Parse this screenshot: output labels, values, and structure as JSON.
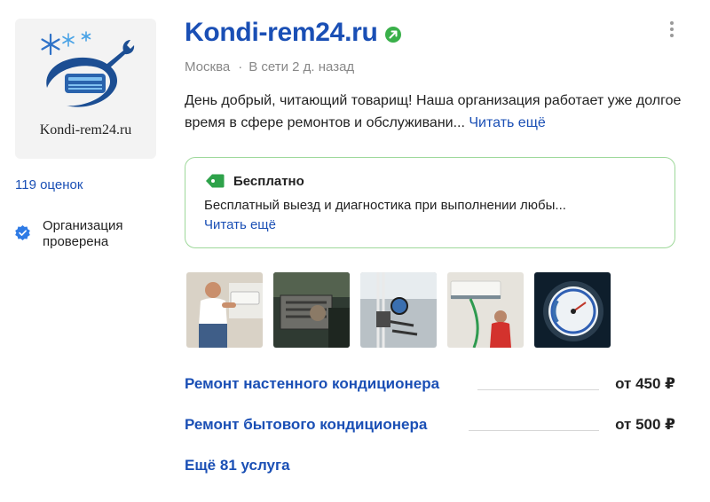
{
  "org": {
    "logo_text": "Kondi-rem24.ru",
    "name": "Kondi-rem24.ru",
    "city": "Москва",
    "online_status": "В сети 2 д. назад",
    "description": "День добрый, читающий товарищ! Наша организация работает уже долгое время в сфере ремонтов и обслуживани...",
    "description_more": "Читать ещё"
  },
  "sidebar": {
    "ratings": "119 оценок",
    "verified": "Организация проверена"
  },
  "promo": {
    "title": "Бесплатно",
    "text": "Бесплатный выезд и диагностика при выполнении любы...",
    "more": "Читать ещё"
  },
  "services": [
    {
      "name": "Ремонт настенного кондиционера",
      "price": "от 450 ₽"
    },
    {
      "name": "Ремонт бытового кондиционера",
      "price": "от 500 ₽"
    }
  ],
  "more_services": "Ещё 81 услуга",
  "colors": {
    "link": "#1a4fb5",
    "verified": "#2f7be5",
    "promo_border": "#9ed89a",
    "promo_tag": "#2ea24a",
    "online_badge": "#3ab04a"
  },
  "icons": {
    "logo": "snowflake-ac-logo",
    "verified": "verified-check-icon",
    "online": "online-arrow-badge-icon",
    "promo": "price-tag-icon",
    "menu": "more-vertical-icon"
  }
}
